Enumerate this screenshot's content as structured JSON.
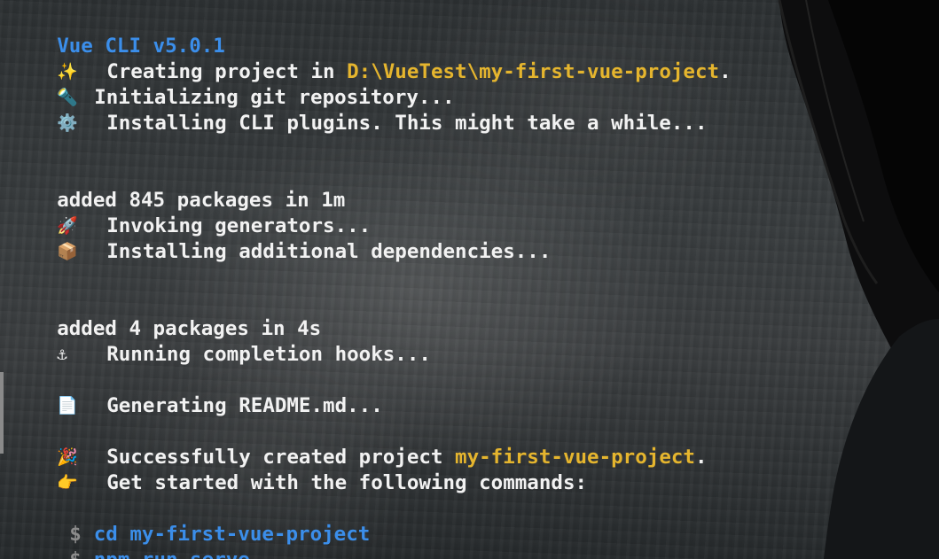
{
  "terminal": {
    "header": "Vue CLI v5.0.1",
    "creating": {
      "icon": "sparkles-icon",
      "glyph": "✨",
      "prefix": "Creating project in ",
      "path": "D:\\VueTest\\my-first-vue-project",
      "suffix": "."
    },
    "git": {
      "icon": "flashlight-icon",
      "glyph": "🔦",
      "text": "Initializing git repository..."
    },
    "plugins": {
      "icon": "gear-icon",
      "glyph": "⚙️",
      "text": "Installing CLI plugins. This might take a while..."
    },
    "added1": "added 845 packages in 1m",
    "generators": {
      "icon": "rocket-icon",
      "glyph": "🚀",
      "text": "Invoking generators..."
    },
    "deps": {
      "icon": "package-icon",
      "glyph": "📦",
      "text": "Installing additional dependencies..."
    },
    "added2": "added 4 packages in 4s",
    "hooks": {
      "icon": "anchor-icon",
      "glyph": "⚓",
      "text": "Running completion hooks..."
    },
    "readme": {
      "icon": "document-icon",
      "glyph": "📄",
      "text": "Generating README.md..."
    },
    "success": {
      "icon": "party-popper-icon",
      "glyph": "🎉",
      "prefix": "Successfully created project ",
      "name": "my-first-vue-project",
      "suffix": "."
    },
    "started": {
      "icon": "pointing-finger-icon",
      "glyph": "👉",
      "text": "Get started with the following commands:"
    },
    "commands": [
      {
        "prompt": "$",
        "text": "cd my-first-vue-project"
      },
      {
        "prompt": "$",
        "text": "npm run serve"
      }
    ]
  },
  "colors": {
    "header": "#3b8eea",
    "path": "#e5b52e",
    "command": "#3b8eea",
    "text": "#f2f2f2"
  }
}
